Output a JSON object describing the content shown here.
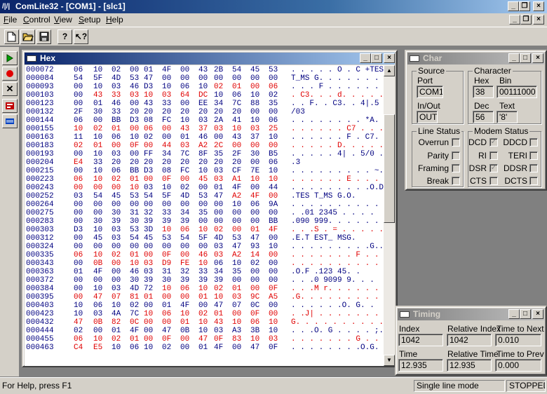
{
  "app": {
    "title": "ComLite32 - [COM1] - [slc1]",
    "icon_text": "/|/|"
  },
  "menu": [
    "File",
    "Control",
    "View",
    "Setup",
    "Help"
  ],
  "toolbar": {
    "new_icon": "new-file-icon",
    "open_icon": "open-folder-icon",
    "save_icon": "save-disk-icon",
    "help_icon": "help-icon",
    "context_help_icon": "context-help-icon"
  },
  "left_toolbar": [
    "run-icon",
    "record-icon",
    "stop-icon",
    "settings-icon",
    "monitor-icon"
  ],
  "hex_window": {
    "title": "Hex",
    "rows": [
      {
        "addr": "000072",
        "bytes": [
          "06",
          "10",
          "02",
          "00",
          "01",
          "4F",
          "00",
          "43",
          "2B",
          "54",
          "45",
          "53"
        ],
        "red": [],
        "ascii": ". . . . . O . C +TES"
      },
      {
        "addr": "000084",
        "bytes": [
          "54",
          "5F",
          "4D",
          "53",
          "47",
          "00",
          "00",
          "00",
          "00",
          "00",
          "00",
          "00"
        ],
        "red": [],
        "ascii": "T_MS G. . . . . . ."
      },
      {
        "addr": "000093",
        "bytes": [
          "00",
          "10",
          "03",
          "46",
          "D3",
          "10",
          "06",
          "10",
          "02",
          "01",
          "00",
          "06"
        ],
        "red": [
          8,
          9,
          10,
          11
        ],
        "ascii": ". . . F . . . . . . . ."
      },
      {
        "addr": "000103",
        "bytes": [
          "00",
          "43",
          "33",
          "03",
          "10",
          "03",
          "64",
          "DC",
          "10",
          "06",
          "10",
          "02"
        ],
        "red": [
          1,
          2,
          3,
          4,
          5,
          6,
          7
        ],
        "ascii": ". C3. . . d. . . . . ."
      },
      {
        "addr": "000123",
        "bytes": [
          "00",
          "01",
          "46",
          "00",
          "43",
          "33",
          "00",
          "EE",
          "34",
          "7C",
          "88",
          "35"
        ],
        "red": [],
        "ascii": ". . F. . C3. . 4|.5"
      },
      {
        "addr": "000132",
        "bytes": [
          "2F",
          "30",
          "33",
          "20",
          "20",
          "20",
          "20",
          "20",
          "20",
          "20",
          "00",
          "00"
        ],
        "red": [],
        "ascii": "/03"
      },
      {
        "addr": "000144",
        "bytes": [
          "06",
          "00",
          "BB",
          "D3",
          "08",
          "FC",
          "10",
          "03",
          "2A",
          "41",
          "10",
          "06"
        ],
        "red": [],
        "ascii": ". . . . . . . . *A. ."
      },
      {
        "addr": "000155",
        "bytes": [
          "10",
          "02",
          "01",
          "00",
          "06",
          "00",
          "43",
          "37",
          "03",
          "10",
          "03",
          "25"
        ],
        "red": [
          0,
          1,
          2,
          3,
          4,
          5,
          6,
          7,
          8,
          9,
          10,
          11
        ],
        "ascii": ". . . . . . C7 . . . %"
      },
      {
        "addr": "000163",
        "bytes": [
          "11",
          "10",
          "06",
          "10",
          "02",
          "00",
          "01",
          "46",
          "00",
          "43",
          "37",
          "10"
        ],
        "red": [],
        "ascii": ". . . . . . F . C7."
      },
      {
        "addr": "000183",
        "bytes": [
          "02",
          "01",
          "00",
          "0F",
          "00",
          "44",
          "03",
          "A2",
          "2C",
          "00",
          "00",
          "00"
        ],
        "red": [
          0,
          1,
          2,
          3,
          4,
          5,
          6,
          7,
          8,
          9,
          10,
          11
        ],
        "ascii": ". . . . . D. . . . ."
      },
      {
        "addr": "000193",
        "bytes": [
          "00",
          "10",
          "03",
          "00",
          "FF",
          "34",
          "7C",
          "8F",
          "35",
          "2F",
          "30",
          "B5"
        ],
        "red": [],
        "ascii": ". . . . . 4| . 5/0 ."
      },
      {
        "addr": "000204",
        "bytes": [
          "E4",
          "33",
          "20",
          "20",
          "20",
          "20",
          "20",
          "20",
          "20",
          "20",
          "00",
          "06"
        ],
        "red": [
          0
        ],
        "ascii": ".3"
      },
      {
        "addr": "000215",
        "bytes": [
          "00",
          "10",
          "06",
          "BB",
          "D3",
          "08",
          "FC",
          "10",
          "03",
          "CF",
          "7E",
          "10"
        ],
        "red": [],
        "ascii": ". . . . . . . . . ~."
      },
      {
        "addr": "000223",
        "bytes": [
          "06",
          "10",
          "02",
          "01",
          "00",
          "0F",
          "00",
          "45",
          "03",
          "A1",
          "10",
          "10"
        ],
        "red": [
          0,
          1,
          2,
          3,
          4,
          5,
          6,
          7,
          8,
          9,
          10,
          11
        ],
        "ascii": ". . . . . . E . . ."
      },
      {
        "addr": "000243",
        "bytes": [
          "00",
          "00",
          "00",
          "10",
          "03",
          "10",
          "02",
          "00",
          "01",
          "4F",
          "00",
          "44"
        ],
        "red": [
          0,
          1,
          2,
          3
        ],
        "ascii": ". . . . . . . . .O.D"
      },
      {
        "addr": "000252",
        "bytes": [
          "03",
          "54",
          "45",
          "53",
          "54",
          "5F",
          "4D",
          "53",
          "47",
          "A2",
          "4F",
          "00"
        ],
        "red": [
          9,
          10,
          11
        ],
        "ascii": ".TES T_MS G.O."
      },
      {
        "addr": "000264",
        "bytes": [
          "00",
          "00",
          "00",
          "00",
          "00",
          "00",
          "00",
          "00",
          "00",
          "10",
          "06",
          "9A"
        ],
        "red": [],
        "ascii": ". . . . . . . . . . ."
      },
      {
        "addr": "000275",
        "bytes": [
          "00",
          "00",
          "30",
          "31",
          "32",
          "33",
          "34",
          "35",
          "00",
          "00",
          "00",
          "00"
        ],
        "red": [],
        "ascii": ". .01 2345 . . . ."
      },
      {
        "addr": "000283",
        "bytes": [
          "00",
          "30",
          "39",
          "30",
          "39",
          "39",
          "39",
          "00",
          "00",
          "00",
          "00",
          "BB"
        ],
        "red": [],
        "ascii": ".090 999. . . . . ."
      },
      {
        "addr": "000303",
        "bytes": [
          "D3",
          "10",
          "03",
          "53",
          "3D",
          "10",
          "06",
          "10",
          "02",
          "00",
          "01",
          "4F"
        ],
        "red": [
          5,
          6,
          7,
          8,
          9,
          10,
          11
        ],
        "ascii": ". . .S . = . . . . .O"
      },
      {
        "addr": "000312",
        "bytes": [
          "00",
          "45",
          "03",
          "54",
          "45",
          "53",
          "54",
          "5F",
          "4D",
          "53",
          "47",
          "00"
        ],
        "red": [],
        "ascii": ".E.T EST_ MSG."
      },
      {
        "addr": "000324",
        "bytes": [
          "00",
          "00",
          "00",
          "00",
          "00",
          "00",
          "00",
          "00",
          "03",
          "47",
          "93",
          "10"
        ],
        "red": [],
        "ascii": ". . . . . . . . .G.."
      },
      {
        "addr": "000335",
        "bytes": [
          "06",
          "10",
          "02",
          "01",
          "00",
          "0F",
          "00",
          "46",
          "03",
          "A2",
          "14",
          "00"
        ],
        "red": [
          0,
          1,
          2,
          3,
          4,
          5,
          6,
          7,
          8,
          9,
          10,
          11
        ],
        "ascii": ". . . . . . . F . ."
      },
      {
        "addr": "000343",
        "bytes": [
          "00",
          "0B",
          "00",
          "10",
          "03",
          "D9",
          "FE",
          "10",
          "06",
          "10",
          "02",
          "00"
        ],
        "red": [
          1,
          2,
          3,
          4,
          5,
          6,
          7
        ],
        "ascii": ". . . . . . . . . . ."
      },
      {
        "addr": "000363",
        "bytes": [
          "01",
          "4F",
          "00",
          "46",
          "03",
          "31",
          "32",
          "33",
          "34",
          "35",
          "00",
          "00"
        ],
        "red": [],
        "ascii": ".O.F .123 45. ."
      },
      {
        "addr": "000372",
        "bytes": [
          "00",
          "00",
          "00",
          "30",
          "39",
          "30",
          "39",
          "39",
          "39",
          "00",
          "00",
          "00"
        ],
        "red": [],
        "ascii": ". . .0 9099 9. . ."
      },
      {
        "addr": "000384",
        "bytes": [
          "00",
          "10",
          "03",
          "4D",
          "72",
          "10",
          "06",
          "10",
          "02",
          "01",
          "00",
          "0F"
        ],
        "red": [
          5,
          6,
          7,
          8,
          9,
          10,
          11
        ],
        "ascii": ". . .M r. . . . . . ."
      },
      {
        "addr": "000395",
        "bytes": [
          "00",
          "47",
          "07",
          "81",
          "01",
          "00",
          "00",
          "01",
          "10",
          "03",
          "9C",
          "A5"
        ],
        "red": [
          0,
          1,
          2,
          3,
          4,
          5,
          6,
          7,
          8,
          9,
          10,
          11
        ],
        "ascii": ".G. . . . . . . . . ."
      },
      {
        "addr": "000403",
        "bytes": [
          "10",
          "06",
          "10",
          "02",
          "00",
          "01",
          "4F",
          "00",
          "47",
          "07",
          "0C",
          "00"
        ],
        "red": [],
        "ascii": ". . . . . .O. G. ."
      },
      {
        "addr": "000423",
        "bytes": [
          "10",
          "03",
          "4A",
          "7C",
          "10",
          "06",
          "10",
          "02",
          "01",
          "00",
          "0F",
          "00"
        ],
        "red": [
          4,
          5,
          6,
          7,
          8,
          9,
          10,
          11
        ],
        "ascii": ". .J| . . . . . . . ."
      },
      {
        "addr": "000432",
        "bytes": [
          "47",
          "0B",
          "82",
          "0C",
          "00",
          "00",
          "01",
          "10",
          "43",
          "10",
          "06",
          "10"
        ],
        "red": [
          0,
          1,
          2,
          3,
          4,
          5,
          6,
          7,
          8,
          9,
          10,
          11
        ],
        "ascii": "G. . . . . . . . . ."
      },
      {
        "addr": "000444",
        "bytes": [
          "02",
          "00",
          "01",
          "4F",
          "00",
          "47",
          "0B",
          "10",
          "03",
          "A3",
          "3B",
          "10"
        ],
        "red": [],
        "ascii": ". . .O. G . . . . ;."
      },
      {
        "addr": "000455",
        "bytes": [
          "06",
          "10",
          "02",
          "01",
          "00",
          "0F",
          "00",
          "47",
          "0F",
          "83",
          "10",
          "03"
        ],
        "red": [
          0,
          1,
          2,
          3,
          4,
          5,
          6,
          7,
          8,
          9,
          10,
          11
        ],
        "ascii": ". . . . . . . G . . ."
      },
      {
        "addr": "000463",
        "bytes": [
          "C4",
          "E5",
          "10",
          "06",
          "10",
          "02",
          "00",
          "01",
          "4F",
          "00",
          "47",
          "0F"
        ],
        "red": [
          0,
          1
        ],
        "ascii": ". . . . . . . .O.G."
      }
    ]
  },
  "char_window": {
    "title": "Char",
    "source": {
      "label": "Source",
      "port_label": "Port",
      "port_value": "COM1",
      "inout_label": "In/Out",
      "inout_value": "OUT"
    },
    "character": {
      "label": "Character",
      "hex_label": "Hex",
      "hex_value": "38",
      "bin_label": "Bin",
      "bin_value": "00111000",
      "dec_label": "Dec",
      "dec_value": "56",
      "text_label": "Text",
      "text_value": "'8'"
    },
    "line_status": {
      "label": "Line Status",
      "items": [
        "Overrun",
        "Parity",
        "Framing",
        "Break"
      ]
    },
    "modem_status": {
      "label": "Modem Status",
      "items": [
        {
          "left": "DCD",
          "left_checked": true,
          "right": "DDCD"
        },
        {
          "left": "RI",
          "left_checked": false,
          "right": "TERI"
        },
        {
          "left": "DSR",
          "left_checked": true,
          "right": "DDSR"
        },
        {
          "left": "CTS",
          "left_checked": false,
          "right": "DCTS"
        }
      ]
    }
  },
  "timing_window": {
    "title": "Timing",
    "index_label": "Index",
    "index_value": "1042",
    "rel_index_label": "Relative Index",
    "rel_index_value": "1042",
    "time_to_next_label": "Time to Next",
    "time_to_next_value": "0.010",
    "time_label": "Time",
    "time_value": "12.935",
    "rel_time_label": "Relative Time",
    "rel_time_value": "12.935",
    "time_to_prev_label": "Time to Prev",
    "time_to_prev_value": "0.000"
  },
  "status": {
    "help": "For Help, press F1",
    "mode": "Single line mode",
    "state": "STOPPED"
  }
}
